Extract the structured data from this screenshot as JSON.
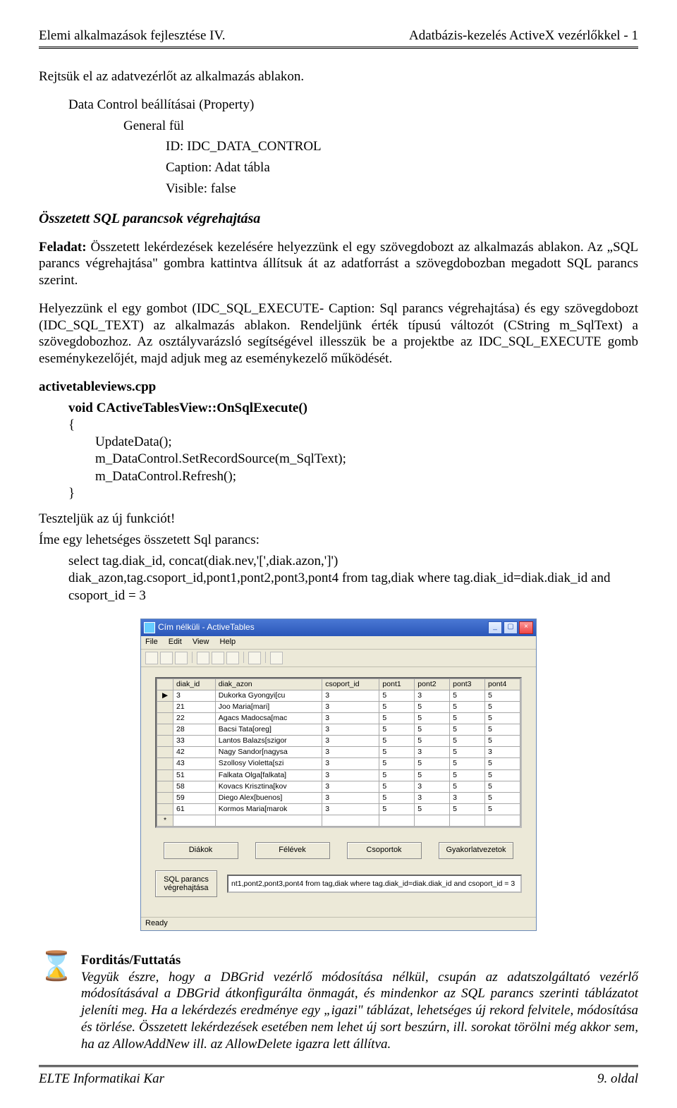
{
  "header": {
    "left": "Elemi alkalmazások fejlesztése IV.",
    "right": "Adatbázis-kezelés ActiveX vezérlőkkel - 1"
  },
  "line1": "Rejtsük el az adatvezérlőt az alkalmazás ablakon.",
  "prop_intro": "Data Control beállításai (Property)",
  "prop_general": "General fül",
  "prop_id": "ID: IDC_DATA_CONTROL",
  "prop_caption": "Caption: Adat tábla",
  "prop_visible": "Visible: false",
  "section_heading": "Összetett SQL parancsok végrehajtása",
  "para_feladat_label": "Feladat:",
  "para_feladat_text": " Összetett lekérdezések kezelésére helyezzünk el egy szövegdobozt az alkalmazás ablakon. Az „SQL parancs végrehajtása\" gombra kattintva állítsuk át az adatforrást a szövegdobozban megadott SQL parancs szerint.",
  "para_helyezzunk": "Helyezzünk el egy gombot (IDC_SQL_EXECUTE- Caption: Sql parancs végrehajtása) és egy szövegdobozt (IDC_SQL_TEXT) az alkalmazás ablakon. Rendeljünk érték típusú változót (CString m_SqlText) a szövegdobozhoz. Az osztályvarázsló segítségével illesszük be a projektbe az IDC_SQL_EXECUTE gomb eseménykezelőjét, majd adjuk meg az eseménykezelő működését.",
  "file_heading": "activetableviews.cpp",
  "code_sig": "void CActiveTablesView::OnSqlExecute()",
  "code_open": "{",
  "code_l1": "        UpdateData();",
  "code_l2": "        m_DataControl.SetRecordSource(m_SqlText);",
  "code_l3": "        m_DataControl.Refresh();",
  "code_close": "}",
  "line_test": "Teszteljük az új funkciót!",
  "line_ime": "Íme egy lehetséges összetett Sql parancs:",
  "sql1": "select tag.diak_id, concat(diak.nev,'[',diak.azon,']')",
  "sql2": "diak_azon,tag.csoport_id,pont1,pont2,pont3,pont4 from tag,diak where tag.diak_id=diak.diak_id and csoport_id = 3",
  "window": {
    "title": "Cím nélküli - ActiveTables",
    "menu": {
      "file": "File",
      "edit": "Edit",
      "view": "View",
      "help": "Help"
    },
    "grid_headers": [
      "diak_id",
      "diak_azon",
      "csoport_id",
      "pont1",
      "pont2",
      "pont3",
      "pont4"
    ],
    "rows": [
      [
        "3",
        "Dukorka Gyongyi[cu",
        "3",
        "5",
        "3",
        "5",
        "5"
      ],
      [
        "21",
        "Joo Maria[mari]",
        "3",
        "5",
        "5",
        "5",
        "5"
      ],
      [
        "22",
        "Agacs Madocsa[mac",
        "3",
        "5",
        "5",
        "5",
        "5"
      ],
      [
        "28",
        "Bacsi Tata[oreg]",
        "3",
        "5",
        "5",
        "5",
        "5"
      ],
      [
        "33",
        "Lantos Balazs[szigor",
        "3",
        "5",
        "5",
        "5",
        "5"
      ],
      [
        "42",
        "Nagy Sandor[nagysa",
        "3",
        "5",
        "3",
        "5",
        "3"
      ],
      [
        "43",
        "Szollosy Violetta[szi",
        "3",
        "5",
        "5",
        "5",
        "5"
      ],
      [
        "51",
        "Falkata Olga[falkata]",
        "3",
        "5",
        "5",
        "5",
        "5"
      ],
      [
        "58",
        "Kovacs Krisztina[kov",
        "3",
        "5",
        "3",
        "5",
        "5"
      ],
      [
        "59",
        "Diego Alex[buenos]",
        "3",
        "5",
        "3",
        "3",
        "5"
      ],
      [
        "61",
        "Kormos Maria[marok",
        "3",
        "5",
        "5",
        "5",
        "5"
      ]
    ],
    "buttons": {
      "diakok": "Diákok",
      "felevek": "Félévek",
      "csoportok": "Csoportok",
      "gyak": "Gyakorlatvezetok"
    },
    "sql_btn": "SQL parancs végrehajtása",
    "sql_text": "nt1,pont2,pont3,pont4 from tag,diak where tag.diak_id=diak.diak_id and csoport_id = 3",
    "status": "Ready"
  },
  "note_heading": "Forditás/Futtatás",
  "note_body": "Vegyük észre, hogy a DBGrid vezérlő módosítása nélkül, csupán az adatszolgáltató vezérlő módosításával a DBGrid átkonfigurálta önmagát, és mindenkor az SQL parancs szerinti táblázatot jeleníti meg. Ha a lekérdezés eredménye egy „igazi\" táblázat, lehetséges új rekord felvitele, módosítása és törlése. Összetett lekérdezések esetében nem lehet új sort beszúrn, ill. sorokat törölni még akkor sem, ha az AllowAddNew ill. az AllowDelete igazra lett állítva.",
  "footer": {
    "left": "ELTE Informatikai Kar",
    "right": "9. oldal"
  }
}
